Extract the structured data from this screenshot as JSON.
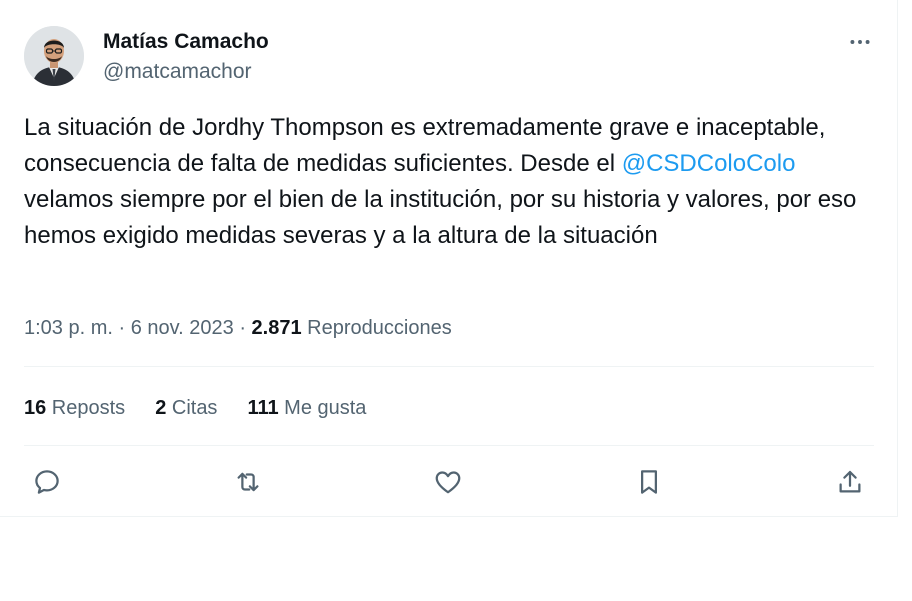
{
  "author": {
    "name": "Matías Camacho",
    "handle": "@matcamachor"
  },
  "tweet": {
    "text_before": "La situación de Jordhy Thompson es extremadamente grave e inaceptable, consecuencia de falta de medidas suficientes. Desde el ",
    "mention": "@CSDColoColo",
    "text_after": " velamos siempre por el bien de la institución, por su historia y valores, por eso hemos exigido medidas severas y a la altura de la situación"
  },
  "meta": {
    "time": "1:03 p. m.",
    "sep1": " · ",
    "date": "6 nov. 2023",
    "sep2": " · ",
    "views_count": "2.871",
    "views_label": " Reproducciones"
  },
  "stats": {
    "reposts_count": "16",
    "reposts_label": " Reposts",
    "quotes_count": "2",
    "quotes_label": " Citas",
    "likes_count": "111",
    "likes_label": " Me gusta"
  },
  "icons": {
    "more": "more-horizontal-icon",
    "reply": "reply-icon",
    "repost": "repost-icon",
    "like": "heart-icon",
    "bookmark": "bookmark-icon",
    "share": "share-icon"
  },
  "colors": {
    "text": "#0f1419",
    "secondary": "#536471",
    "link": "#1d9bf0",
    "divider": "#eff3f4"
  }
}
